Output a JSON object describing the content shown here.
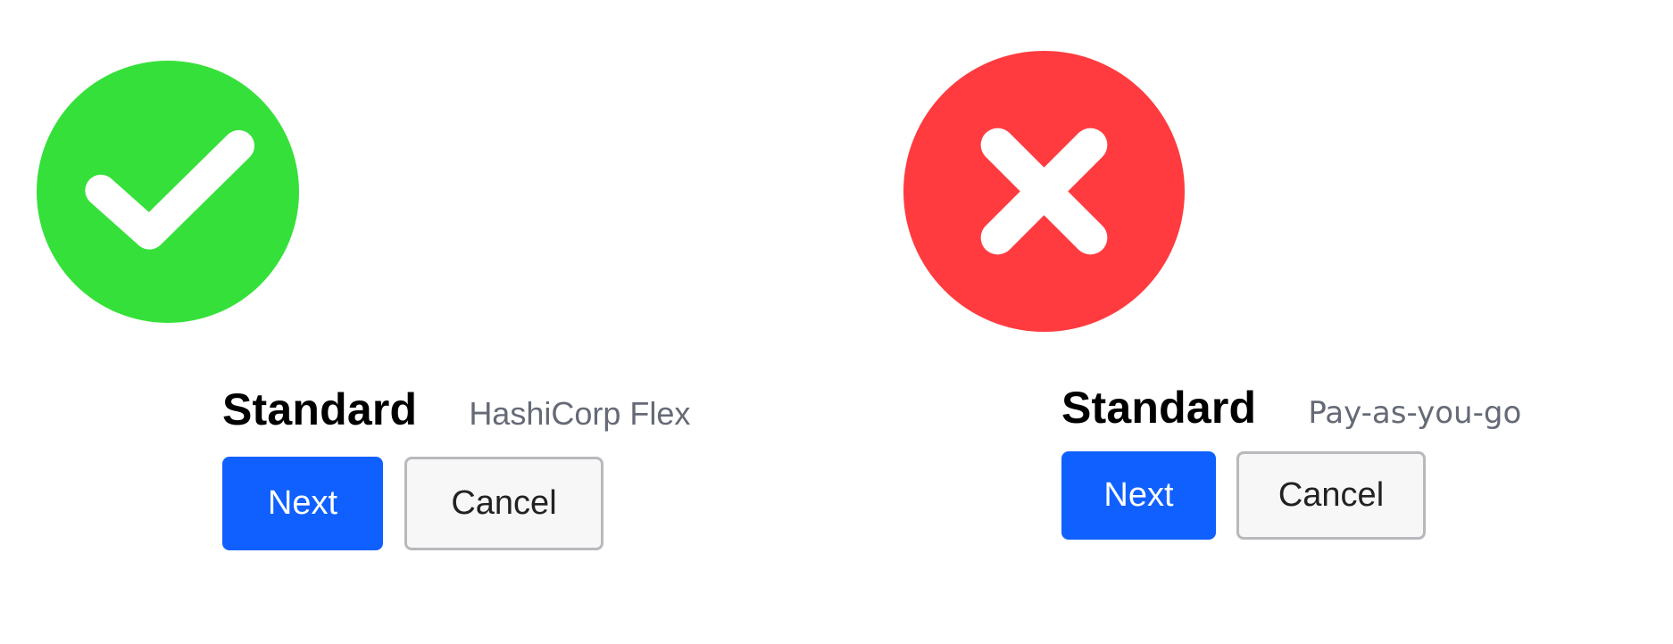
{
  "colors": {
    "success": "#36e03a",
    "error": "#ff3b3f",
    "primary_button": "#1060ff",
    "secondary_text": "#656a76"
  },
  "correct_example": {
    "icon": "check-circle-icon",
    "tier": "Standard",
    "plan": "HashiCorp Flex",
    "next_label": "Next",
    "cancel_label": "Cancel"
  },
  "incorrect_example": {
    "icon": "x-circle-icon",
    "tier": "Standard",
    "plan": "Pay-as-you-go",
    "next_label": "Next",
    "cancel_label": "Cancel"
  }
}
